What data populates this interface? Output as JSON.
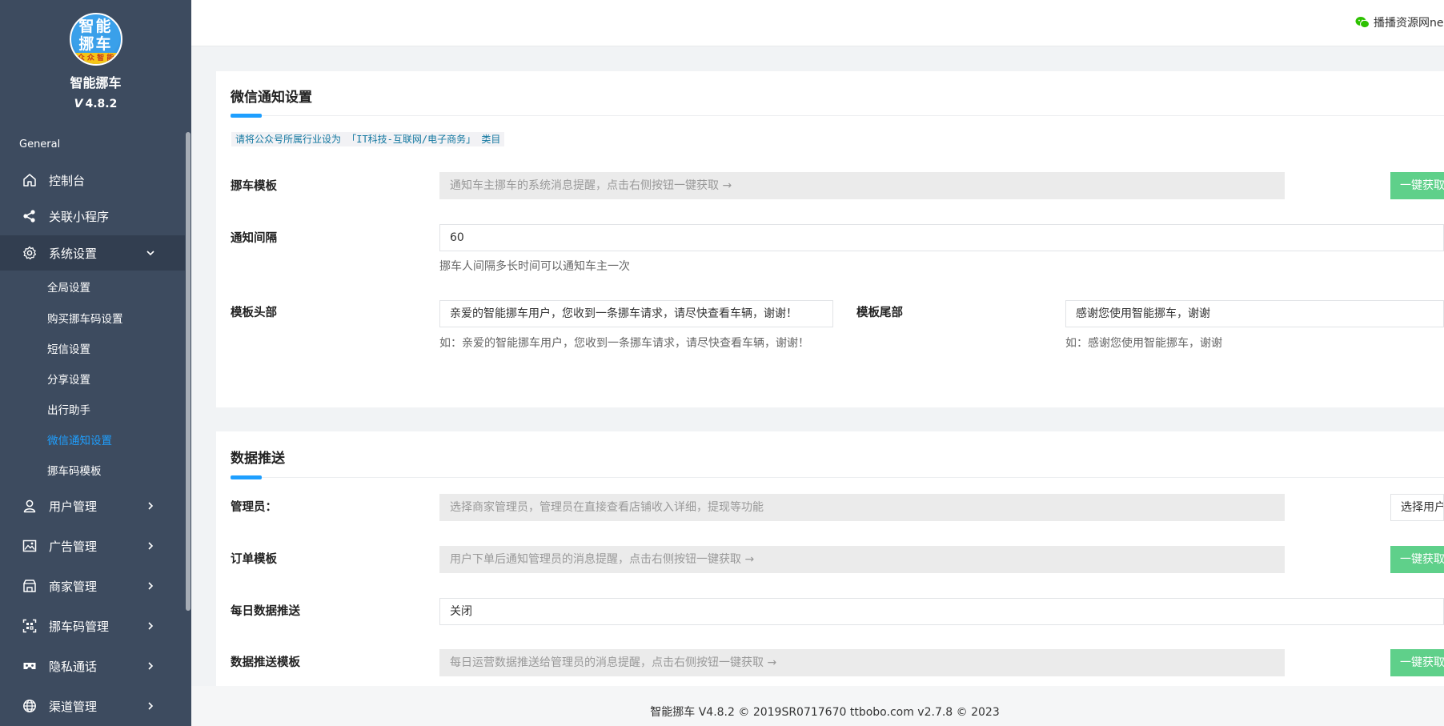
{
  "brand": {
    "logo_line1": "智能",
    "logo_line2": "挪车",
    "logo_band": "众 众 智 能",
    "name": "智能挪车",
    "version_mark": "V",
    "version": "4.8.2"
  },
  "sidebar": {
    "section": "General",
    "items": [
      {
        "label": "控制台",
        "icon": "home-icon"
      },
      {
        "label": "关联小程序",
        "icon": "share-icon"
      },
      {
        "label": "系统设置",
        "icon": "gear-icon",
        "expanded": true
      },
      {
        "label": "用户管理",
        "icon": "user-icon"
      },
      {
        "label": "广告管理",
        "icon": "image-icon"
      },
      {
        "label": "商家管理",
        "icon": "shop-icon"
      },
      {
        "label": "挪车码管理",
        "icon": "qrcode-icon"
      },
      {
        "label": "隐私通话",
        "icon": "vr-icon"
      },
      {
        "label": "渠道管理",
        "icon": "globe-icon"
      }
    ],
    "sub_items": [
      {
        "label": "全局设置"
      },
      {
        "label": "购买挪车码设置"
      },
      {
        "label": "短信设置"
      },
      {
        "label": "分享设置"
      },
      {
        "label": "出行助手"
      },
      {
        "label": "微信通知设置",
        "active": true
      },
      {
        "label": "挪车码模板"
      }
    ]
  },
  "header": {
    "right_text": "播播资源网ne",
    "wechat_icon": "wechat-icon"
  },
  "wechat_card": {
    "title": "微信通知设置",
    "notice": "请将公众号所属行业设为 「IT科技-互联网/电子商务」 类目",
    "fields": {
      "template_label": "挪车模板",
      "template_placeholder": "通知车主挪车的系统消息提醒，点击右侧按钮一键获取 →",
      "template_button": "一键获取",
      "interval_label": "通知间隔",
      "interval_value": "60",
      "interval_help": "挪车人间隔多长时间可以通知车主一次",
      "head_label": "模板头部",
      "head_value": "亲爱的智能挪车用户，您收到一条挪车请求，请尽快查看车辆，谢谢！",
      "head_help": "如：亲爱的智能挪车用户，您收到一条挪车请求，请尽快查看车辆，谢谢！",
      "tail_label": "模板尾部",
      "tail_value": "感谢您使用智能挪车，谢谢",
      "tail_help": "如：感谢您使用智能挪车，谢谢"
    }
  },
  "push_card": {
    "title": "数据推送",
    "fields": {
      "admin_label": "管理员：",
      "admin_placeholder": "选择商家管理员，管理员在直接查看店铺收入详细，提现等功能",
      "admin_button": "选择用户",
      "order_label": "订单模板",
      "order_placeholder": "用户下单后通知管理员的消息提醒，点击右侧按钮一键获取 →",
      "order_button": "一键获取",
      "daily_label": "每日数据推送",
      "daily_value": "关闭",
      "push_label": "数据推送模板",
      "push_placeholder": "每日运营数据推送给管理员的消息提醒，点击右侧按钮一键获取 →",
      "push_button": "一键获取"
    }
  },
  "footer": {
    "text": "智能挪车 V4.8.2 © 2019SR0717670 ttbobo.com v2.7.8 © 2023"
  },
  "colors": {
    "sidebar_bg": "#3d4b5f",
    "accent": "#1e9fff",
    "button_green": "#5fd08a"
  }
}
